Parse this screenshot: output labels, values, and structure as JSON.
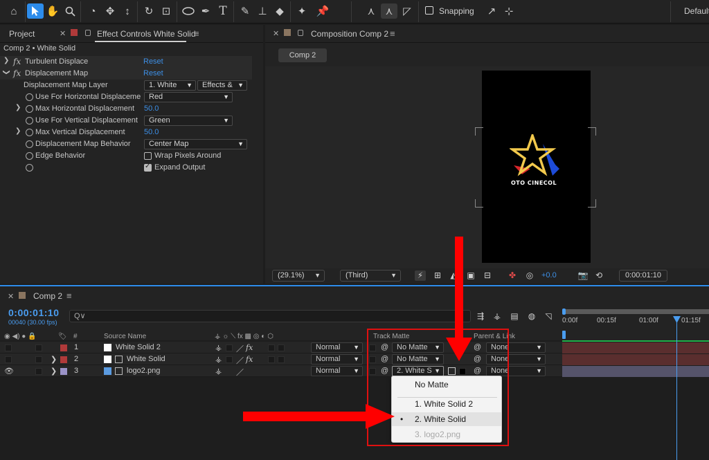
{
  "toolbar": {
    "snapping_label": "Snapping",
    "workspace_label": "Default"
  },
  "effect_controls": {
    "tab_project": "Project",
    "tab_effect_controls": "Effect Controls White Solid",
    "breadcrumb": "Comp 2 • White Solid",
    "effects": [
      {
        "name": "Turbulent Displace",
        "reset": "Reset"
      },
      {
        "name": "Displacement Map",
        "reset": "Reset"
      }
    ],
    "properties": {
      "map_layer_label": "Displacement Map Layer",
      "map_layer_value": "1. White",
      "map_layer_source": "Effects &",
      "use_horizontal_label": "Use For Horizontal Displaceme",
      "use_horizontal_value": "Red",
      "max_horizontal_label": "Max Horizontal Displacement",
      "max_horizontal_value": "50.0",
      "use_vertical_label": "Use For Vertical Displacement",
      "use_vertical_value": "Green",
      "max_vertical_label": "Max Vertical Displacement",
      "max_vertical_value": "50.0",
      "behavior_label": "Displacement Map Behavior",
      "behavior_value": "Center Map",
      "edge_label": "Edge Behavior",
      "wrap_label": "Wrap Pixels Around",
      "wrap_checked": false,
      "expand_label": "Expand Output",
      "expand_checked": true
    }
  },
  "composition": {
    "tab_label": "Composition Comp 2",
    "comp_button": "Comp 2",
    "logo_text": "OTO CINECOL",
    "zoom": "(29.1%)",
    "resolution": "(Third)",
    "exposure": "+0.0",
    "timecode": "0:00:01:10"
  },
  "timeline": {
    "tab_label": "Comp 2",
    "timecode": "0:00:01:10",
    "frames": "00040 (30.00 fps)",
    "search_placeholder": "Q∨",
    "headers": {
      "number": "#",
      "source_name": "Source Name",
      "track_matte": "Track Matte",
      "parent_link": "Parent & Link"
    },
    "ruler": [
      "0:00f",
      "00:15f",
      "01:00f",
      "01:15f"
    ],
    "layers": [
      {
        "num": "1",
        "name": "White Solid 2",
        "mode": "Normal",
        "matte": "No Matte",
        "parent": "None",
        "label_color": "#b03a3a"
      },
      {
        "num": "2",
        "name": "White Solid",
        "mode": "Normal",
        "matte": "No Matte",
        "parent": "None",
        "label_color": "#b03a3a"
      },
      {
        "num": "3",
        "name": "logo2.png",
        "mode": "Normal",
        "matte": "2. White S",
        "parent": "None",
        "label_color": "#9b93c8"
      }
    ],
    "matte_menu": {
      "items": [
        "No Matte",
        "1. White Solid 2",
        "2. White Solid",
        "3. logo2.png"
      ],
      "selected_index": 2,
      "disabled_index": 3
    }
  },
  "colors": {
    "accent_blue": "#2d8ceb",
    "annotation_red": "#ff0000",
    "layer_red": "#b03a3a",
    "layer_lavender": "#9b93c8",
    "track_red": "#5a2e2e",
    "track_green": "#22b34a"
  }
}
